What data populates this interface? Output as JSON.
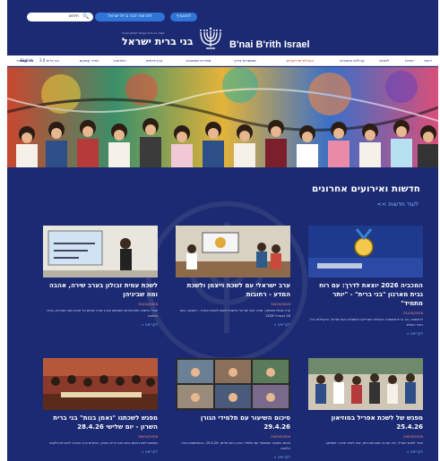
{
  "header": {
    "search_placeholder": "חיפוש",
    "donate_label": "לתרומה לבני ברית ישראל",
    "login_label": "להצטרף",
    "logo_he": "בני ברית ישראל",
    "logo_sub": "מסדר בני ברית העולמי לשלום ישראל",
    "logo_en": "B'nai B'rith Israel"
  },
  "nav": {
    "items": [
      "ראשי",
      "אודות",
      "לשכות",
      "קהילות ואתגרים",
      "פעילות ופרויקטים",
      "ממוסדות בדרך",
      "ספריית משאבים",
      "קרן פרסים",
      "התרבות",
      "מדור עסקים",
      "בני ברית 2.0",
      "מאגר",
      "צור קשר",
      "English"
    ],
    "active_index": 4
  },
  "section": {
    "title": "חדשות ואירועים אחרונים",
    "more_link": "לעוד חדשות >>"
  },
  "cards": [
    {
      "title": "המכביה 2026 יוצאת לדרך: עם רוח גבית מארגון \"בני ברית\" - \"יותר מתמיד\"",
      "date": "01/05/2026",
      "excerpt": "לראשונה, בני ברית ממשיכה בהובלת הפרויקט המשותף בעם ישראל, ובקהילות בכל רחבי העולם",
      "more": "לקריאה »"
    },
    {
      "title": "ערב ישראלי עם לשכת וייצמן ולשכת המדע - רחובות",
      "date": "30/04/2026",
      "excerpt": "ערב שכולו מוסיקה, שירה והווי ישראלי בלשכת וייצמן ולשכת המדע - רחובות, ביום 28 באפריל 2026",
      "more": "לקריאה »"
    },
    {
      "title": "לשכת עמית זבולון בערב שירה, אהבה ומה שביניהן",
      "date": "30/04/2026",
      "excerpt": "חברי הלשכה וחברותיהם השתתפו בערב שירה מרגש על אהבה ומה שביניהן, בבית הלשכה",
      "more": "לקריאה »"
    },
    {
      "title": "מפגש של לשכת אפריל במוזיאון 25.4.26",
      "date": "29/04/2026",
      "excerpt": "חברי לשכת אפריל, יחד עם בני זוגם ואורחים, יצאו לסיור מודרך במוזיאון",
      "more": "לקריאה »"
    },
    {
      "title": "סיכום השיעור עם תלמידי הגורן 29.4.26",
      "date": "29/04/2026",
      "excerpt": "סיכום השיעור המשותף עם תלמידי הגורן ביום שלישי, 29.4.26, בהשתתפות חברי הלשכה",
      "more": "לקריאה »"
    },
    {
      "title": "מפגש לשכתנו \"נאמן בנות\" בני ברית השרון - יום שלישי 28.4.26",
      "date": "28/04/2026",
      "excerpt": "במפגש לשכת נאמן בנות מבני ברית השרון, התקיים ערב הוקרה לחברות הלשכה",
      "more": "לקריאה »"
    }
  ],
  "colors": {
    "brand_navy": "#1b2a72",
    "accent_blue": "#2f74d6",
    "link_blue": "#7ab8ff",
    "date_red": "#ff8a8a",
    "active_nav": "#d8302a"
  }
}
